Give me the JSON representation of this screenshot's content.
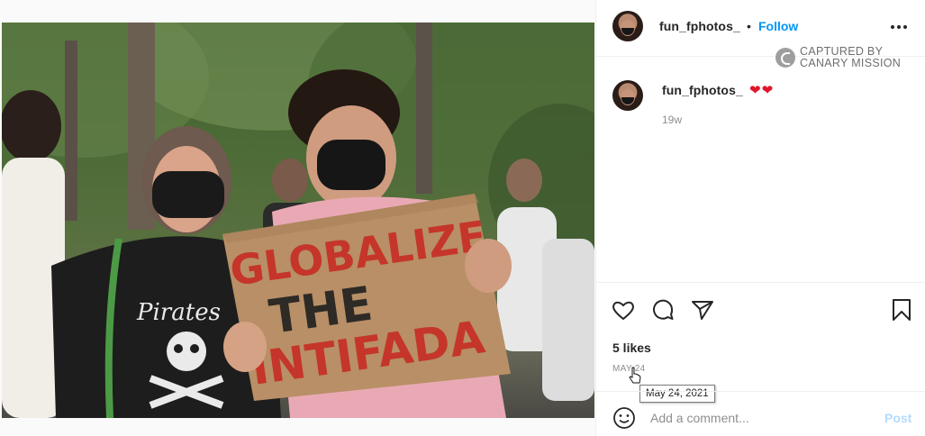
{
  "post": {
    "username": "fun_fphotos_",
    "follow_label": "Follow",
    "separator": "•",
    "watermark_line1": "CAPTURED BY",
    "watermark_line2": "CANARY MISSION",
    "caption_username": "fun_fphotos_",
    "caption_text": "❤❤",
    "age": "19w",
    "likes": "5 likes",
    "date": "MAY 24",
    "date_tooltip": "May 24, 2021",
    "comment_placeholder": "Add a comment...",
    "post_label": "Post",
    "sign_line1": "GLOBALIZE",
    "sign_line2": "THE",
    "sign_line3": "INTIFADA",
    "shirt_text": "Pirates"
  },
  "icons": {
    "more": "more-options-icon",
    "like": "heart-icon",
    "comment": "comment-icon",
    "share": "paper-plane-icon",
    "save": "bookmark-icon",
    "emoji": "smiley-icon"
  },
  "colors": {
    "link": "#0095f6",
    "post_disabled": "#b3dbff",
    "hearts": "#e0162b",
    "muted": "#8e8e8e"
  }
}
